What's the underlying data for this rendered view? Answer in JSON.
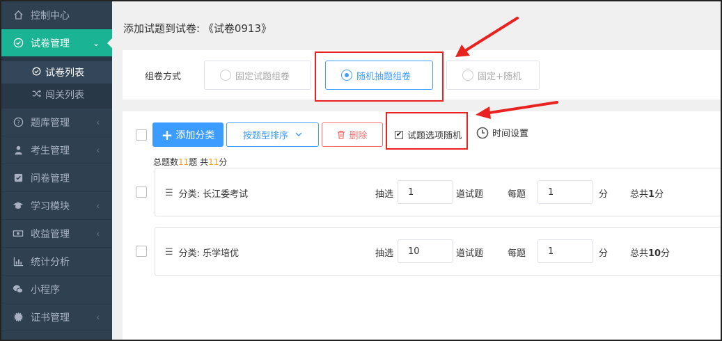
{
  "sidebar": {
    "items": [
      {
        "label": "控制中心",
        "icon": "home-icon",
        "arrow": ""
      },
      {
        "label": "试卷管理",
        "icon": "check-circle-icon",
        "arrow": "⌄"
      },
      {
        "label": "题库管理",
        "icon": "question-circle-icon",
        "arrow": "‹"
      },
      {
        "label": "考生管理",
        "icon": "user-icon",
        "arrow": "‹"
      },
      {
        "label": "问卷管理",
        "icon": "check-square-icon",
        "arrow": ""
      },
      {
        "label": "学习模块",
        "icon": "graduation-cap-icon",
        "arrow": "‹"
      },
      {
        "label": "收益管理",
        "icon": "money-icon",
        "arrow": "‹"
      },
      {
        "label": "统计分析",
        "icon": "bar-chart-icon",
        "arrow": ""
      },
      {
        "label": "小程序",
        "icon": "wechat-icon",
        "arrow": ""
      },
      {
        "label": "证书管理",
        "icon": "certificate-icon",
        "arrow": "‹"
      }
    ],
    "sub_items": [
      {
        "label": "试卷列表",
        "icon": "check-circle-small-icon"
      },
      {
        "label": "闯关列表",
        "icon": "shuffle-icon"
      }
    ]
  },
  "page": {
    "title": "添加试题到试卷: 《试卷0913》"
  },
  "mode": {
    "label": "组卷方式",
    "options": [
      "固定试题组卷",
      "随机抽题组卷",
      "固定+随机"
    ],
    "selected": "随机抽题组卷"
  },
  "toolbar": {
    "add_category": "添加分类",
    "sort_by_type": "按题型排序",
    "delete": "删除",
    "shuffle_options": "试题选项随机",
    "time_settings": "时间设置"
  },
  "summary": {
    "prefix": "总题数",
    "count": "11",
    "mid": "题 共",
    "score": "11",
    "suffix": "分"
  },
  "categories": [
    {
      "name": "分类: 长江委考试",
      "draw_label": "抽选",
      "draw_value": "1",
      "unit_q": "道试题",
      "per_label": "每题",
      "per_value": "1",
      "unit_s": "分",
      "total_prefix": "总共",
      "total_value": "1",
      "total_suffix": "分"
    },
    {
      "name": "分类: 乐学培优",
      "draw_label": "抽选",
      "draw_value": "10",
      "unit_q": "道试题",
      "per_label": "每题",
      "per_value": "1",
      "unit_s": "分",
      "total_prefix": "总共",
      "total_value": "10",
      "total_suffix": "分"
    }
  ],
  "colors": {
    "sidebar": "#2f4050",
    "active": "#1ab394",
    "primary": "#409eff",
    "danger": "#f56c6c",
    "annotation": "#e8231f",
    "highlight": "#f0a020"
  }
}
